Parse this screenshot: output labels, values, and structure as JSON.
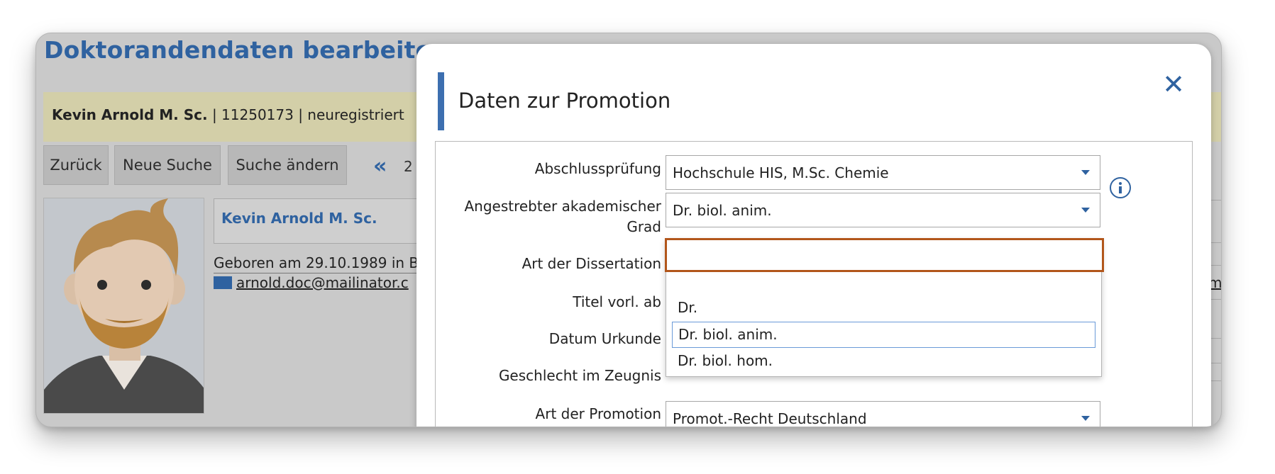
{
  "background": {
    "page_title": "Doktorandendaten bearbeiten",
    "info_bar": {
      "name": "Kevin Arnold M. Sc.",
      "rest": " | 11250173 | neuregistriert"
    },
    "buttons": {
      "back": "Zurück",
      "new_search": "Neue Suche",
      "change_search": "Suche ändern"
    },
    "nav_arrow": "«",
    "nav_page": "2",
    "person": {
      "name": "Kevin Arnold M. Sc.",
      "born": "Geboren am 29.10.1989 in B",
      "email": "arnold.doc@mailinator.c"
    },
    "right_fragment": "m"
  },
  "modal": {
    "title": "Daten zur Promotion",
    "close_symbol": "✕",
    "fields": {
      "abschluss_label": "Abschlussprüfung",
      "abschluss_value": "Hochschule HIS, M.Sc. Chemie",
      "grad_label_line1": "Angestrebter akademischer",
      "grad_label_line2": "Grad",
      "grad_value": "Dr. biol. anim.",
      "dissertation_label": "Art der Dissertation",
      "titel_label": "Titel vorl. ab",
      "datum_label": "Datum Urkunde",
      "geschlecht_label": "Geschlecht im Zeugnis",
      "promotion_label": "Art der Promotion",
      "promotion_value": "Promot.-Recht Deutschland"
    },
    "dropdown": {
      "search_value": "",
      "options": [
        "Dr.",
        "Dr. biol. anim.",
        "Dr. biol. hom."
      ],
      "selected_index": 1
    }
  },
  "colors": {
    "accent_blue": "#2f62a0",
    "focus_orange": "#b2561b",
    "info_bar_bg": "#d3cfa8"
  }
}
